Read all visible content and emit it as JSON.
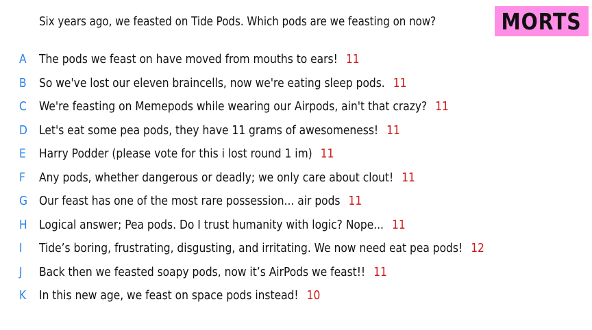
{
  "question": "Six years ago, we feasted on Tide Pods. Which pods are we feasting on now?",
  "player_tag": "MORTS",
  "colors": {
    "letter": "#2a82e6",
    "score": "#d01818",
    "badge": "#ff8ee6"
  },
  "answers": [
    {
      "letter": "A",
      "text": "The pods we feast on have moved from mouths to ears!",
      "score": "11"
    },
    {
      "letter": "B",
      "text": "So we've lost our eleven braincells, now we're eating sleep pods.",
      "score": "11"
    },
    {
      "letter": "C",
      "text": "We're feasting on Memepods while wearing our Airpods, ain't that crazy?",
      "score": "11"
    },
    {
      "letter": "D",
      "text": "Let's eat some pea pods, they have 11 grams of awesomeness!",
      "score": "11"
    },
    {
      "letter": "E",
      "text": "Harry Podder (please vote for this i lost round 1 im)",
      "score": "11"
    },
    {
      "letter": "F",
      "text": "Any pods, whether dangerous or deadly; we only care about clout!",
      "score": "11"
    },
    {
      "letter": "G",
      "text": "Our feast has one of the most rare possession... air pods",
      "score": "11"
    },
    {
      "letter": "H",
      "text": "Logical answer; Pea pods. Do I trust humanity with logic? Nope...",
      "score": "11"
    },
    {
      "letter": "I",
      "text": "Tide’s boring, frustrating, disgusting, and irritating. We now need eat pea pods!",
      "score": "12"
    },
    {
      "letter": "J",
      "text": "Back then we feasted soapy pods, now it’s AirPods we feast!!",
      "score": "11"
    },
    {
      "letter": "K",
      "text": "In this new age, we feast on space pods instead!",
      "score": "10"
    }
  ]
}
